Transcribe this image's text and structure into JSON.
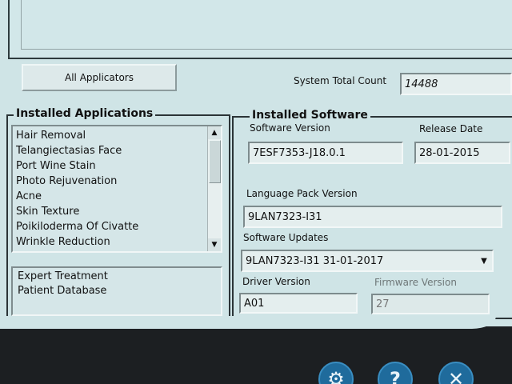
{
  "buttons": {
    "all_applicators": "All Applicators"
  },
  "system_total_count": {
    "label": "System Total Count",
    "value": "14488"
  },
  "installed_applications": {
    "title": "Installed Applications",
    "items": [
      "Hair Removal",
      "Telangiectasias Face",
      "Port Wine Stain",
      "Photo Rejuvenation",
      "Acne",
      "Skin Texture",
      "Poikiloderma Of Civatte",
      "Wrinkle Reduction"
    ],
    "options": [
      "Expert Treatment",
      "Patient Database"
    ]
  },
  "installed_software": {
    "title": "Installed Software",
    "software_version_label": "Software Version",
    "software_version": "7ESF7353-J18.0.1",
    "release_date_label": "Release Date",
    "release_date": "28-01-2015",
    "language_pack_label": "Language Pack Version",
    "language_pack": "9LAN7323-I31",
    "software_updates_label": "Software Updates",
    "software_updates": "9LAN7323-I31 31-01-2017",
    "driver_version_label": "Driver Version",
    "driver_version": "A01",
    "firmware_version_label": "Firmware Version",
    "firmware_version": "27"
  },
  "icons": {
    "settings": "gear-icon",
    "help": "question-icon",
    "close": "close-icon"
  },
  "colors": {
    "panel_bg": "#cfe4e6",
    "button_blue": "#1f6b9c"
  }
}
